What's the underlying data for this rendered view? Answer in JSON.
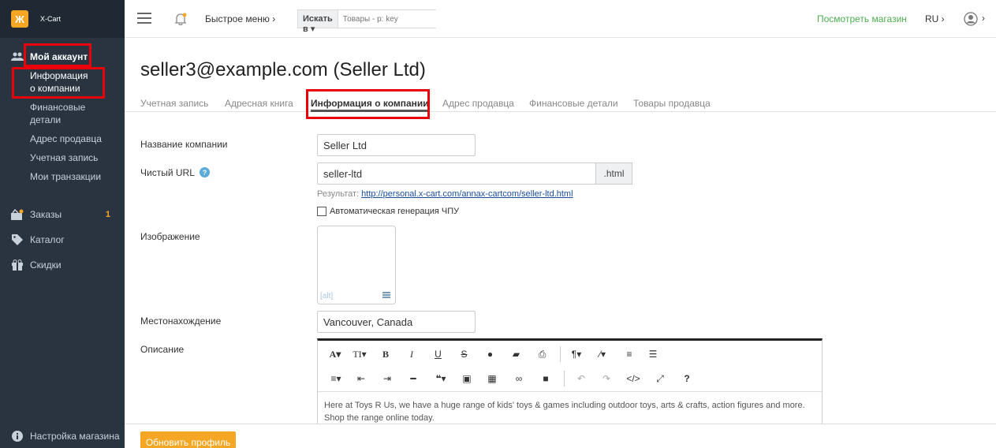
{
  "app": {
    "brand": "X-Cart",
    "logo_glyph": "Ж"
  },
  "sidebar": {
    "account": {
      "label": "Мой аккаунт",
      "items": [
        {
          "label": "Информация о компании"
        },
        {
          "label": "Финансовые детали"
        },
        {
          "label": "Адрес продавца"
        },
        {
          "label": "Учетная запись"
        },
        {
          "label": "Мои транзакции"
        }
      ]
    },
    "orders": {
      "label": "Заказы",
      "badge": "1"
    },
    "catalog": {
      "label": "Каталог"
    },
    "discounts": {
      "label": "Скидки"
    },
    "settings": {
      "label": "Настройка магазина"
    }
  },
  "topbar": {
    "quick_menu": "Быстрое меню ›",
    "search_scope": "Искать в ▾",
    "search_placeholder": "Товары - р: key",
    "view_store": "Посмотреть магазин",
    "lang": "RU ›",
    "user_caret": "›"
  },
  "page": {
    "title": "seller3@example.com (Seller Ltd)",
    "tabs": [
      {
        "label": "Учетная запись"
      },
      {
        "label": "Адресная книга"
      },
      {
        "label": "Информация о компании",
        "active": true
      },
      {
        "label": "Адрес продавца"
      },
      {
        "label": "Финансовые детали"
      },
      {
        "label": "Товары продавца"
      }
    ]
  },
  "form": {
    "company_name_label": "Название компании",
    "company_name_value": "Seller Ltd",
    "clean_url_label": "Чистый URL",
    "clean_url_value": "seller-ltd",
    "clean_url_suffix": ".html",
    "result_label": "Результат:",
    "result_url": "http://personal.x-cart.com/annax-cartcom/seller-ltd.html",
    "auto_gen_label": "Автоматическая генерация ЧПУ",
    "auto_gen_checked": false,
    "image_label": "Изображение",
    "image_alt": "[alt]",
    "location_label": "Местонахождение",
    "location_value": "Vancouver, Canada",
    "description_label": "Описание",
    "description_text": "Here at Toys R Us, we have a huge range of kids' toys & games including outdoor toys, arts & crafts, action figures and more. Shop the range online today."
  },
  "footer": {
    "update_button": "Обновить профиль"
  },
  "colors": {
    "sidebar_bg": "#2a3441",
    "accent": "#f5a623",
    "link_green": "#4caf50",
    "highlight": "#e8000b"
  }
}
